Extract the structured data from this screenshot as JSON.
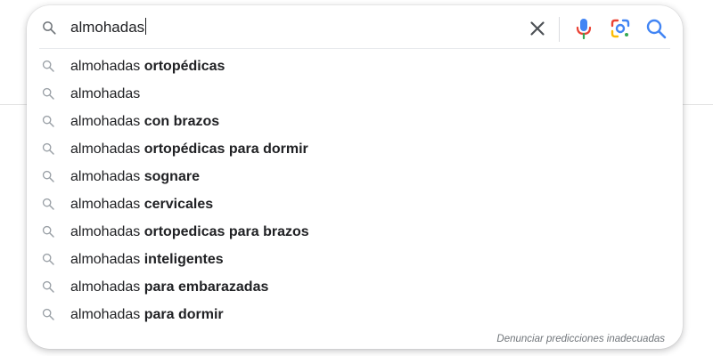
{
  "search": {
    "query": "almohadas",
    "clear_icon": "close-icon",
    "voice_icon": "microphone-icon",
    "image_icon": "google-lens-icon",
    "search_icon": "search-icon"
  },
  "suggestions": [
    {
      "prefix": "almohadas",
      "completion": " ortopédicas"
    },
    {
      "prefix": "almohadas",
      "completion": ""
    },
    {
      "prefix": "almohadas",
      "completion": " con brazos"
    },
    {
      "prefix": "almohadas",
      "completion": " ortopédicas para dormir"
    },
    {
      "prefix": "almohadas",
      "completion": " sognare"
    },
    {
      "prefix": "almohadas",
      "completion": " cervicales"
    },
    {
      "prefix": "almohadas",
      "completion": " ortopedicas para brazos"
    },
    {
      "prefix": "almohadas",
      "completion": " inteligentes"
    },
    {
      "prefix": "almohadas",
      "completion": " para embarazadas"
    },
    {
      "prefix": "almohadas",
      "completion": " para dormir"
    }
  ],
  "footer": {
    "report_link": "Denunciar predicciones inadecuadas"
  },
  "colors": {
    "text": "#202124",
    "icon_gray": "#70757a",
    "mic_blue": "#4285f4",
    "mic_red": "#ea4335",
    "lens_yellow": "#fbbc04",
    "lens_green": "#34a853",
    "search_blue": "#4285f4"
  }
}
